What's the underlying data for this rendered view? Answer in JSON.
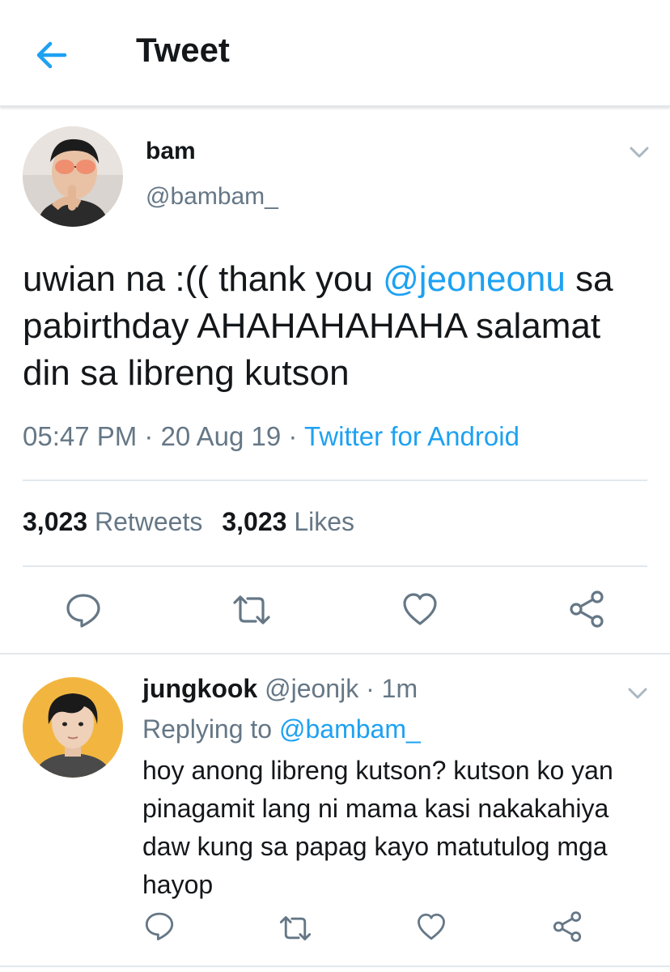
{
  "header": {
    "title": "Tweet"
  },
  "tweet": {
    "author": {
      "name": "bam",
      "handle": "@bambam_"
    },
    "text_before": "uwian na :(( thank you ",
    "mention": "@jeoneonu",
    "text_after": " sa pabirthday AHAHAHAHAHA salamat din sa libreng kutson",
    "time": "05:47 PM",
    "sep1": " · ",
    "date": "20 Aug 19",
    "sep2": " · ",
    "source": "Twitter for Android",
    "stats": {
      "retweets_count": "3,023",
      "retweets_label": "Retweets",
      "likes_count": "3,023",
      "likes_label": "Likes"
    }
  },
  "reply": {
    "author": {
      "name": "jungkook",
      "handle": "@jeonjk"
    },
    "sep": " · ",
    "time": "1m",
    "replying_label": "Replying to ",
    "replying_to": "@bambam_",
    "text": "hoy anong libreng kutson? kutson ko yan pinagamit lang ni mama kasi nakakahiya daw kung sa papag kayo matutulog mga hayop"
  },
  "icons": {
    "back": "arrow-left-icon",
    "more": "chevron-down-icon",
    "reply": "speech-bubble-icon",
    "retweet": "retweet-icon",
    "like": "heart-icon",
    "share": "share-icon"
  },
  "colors": {
    "accent": "#1da1f2",
    "secondary_text": "#657786",
    "primary_text": "#14171a",
    "divider": "#e1e8ed"
  }
}
